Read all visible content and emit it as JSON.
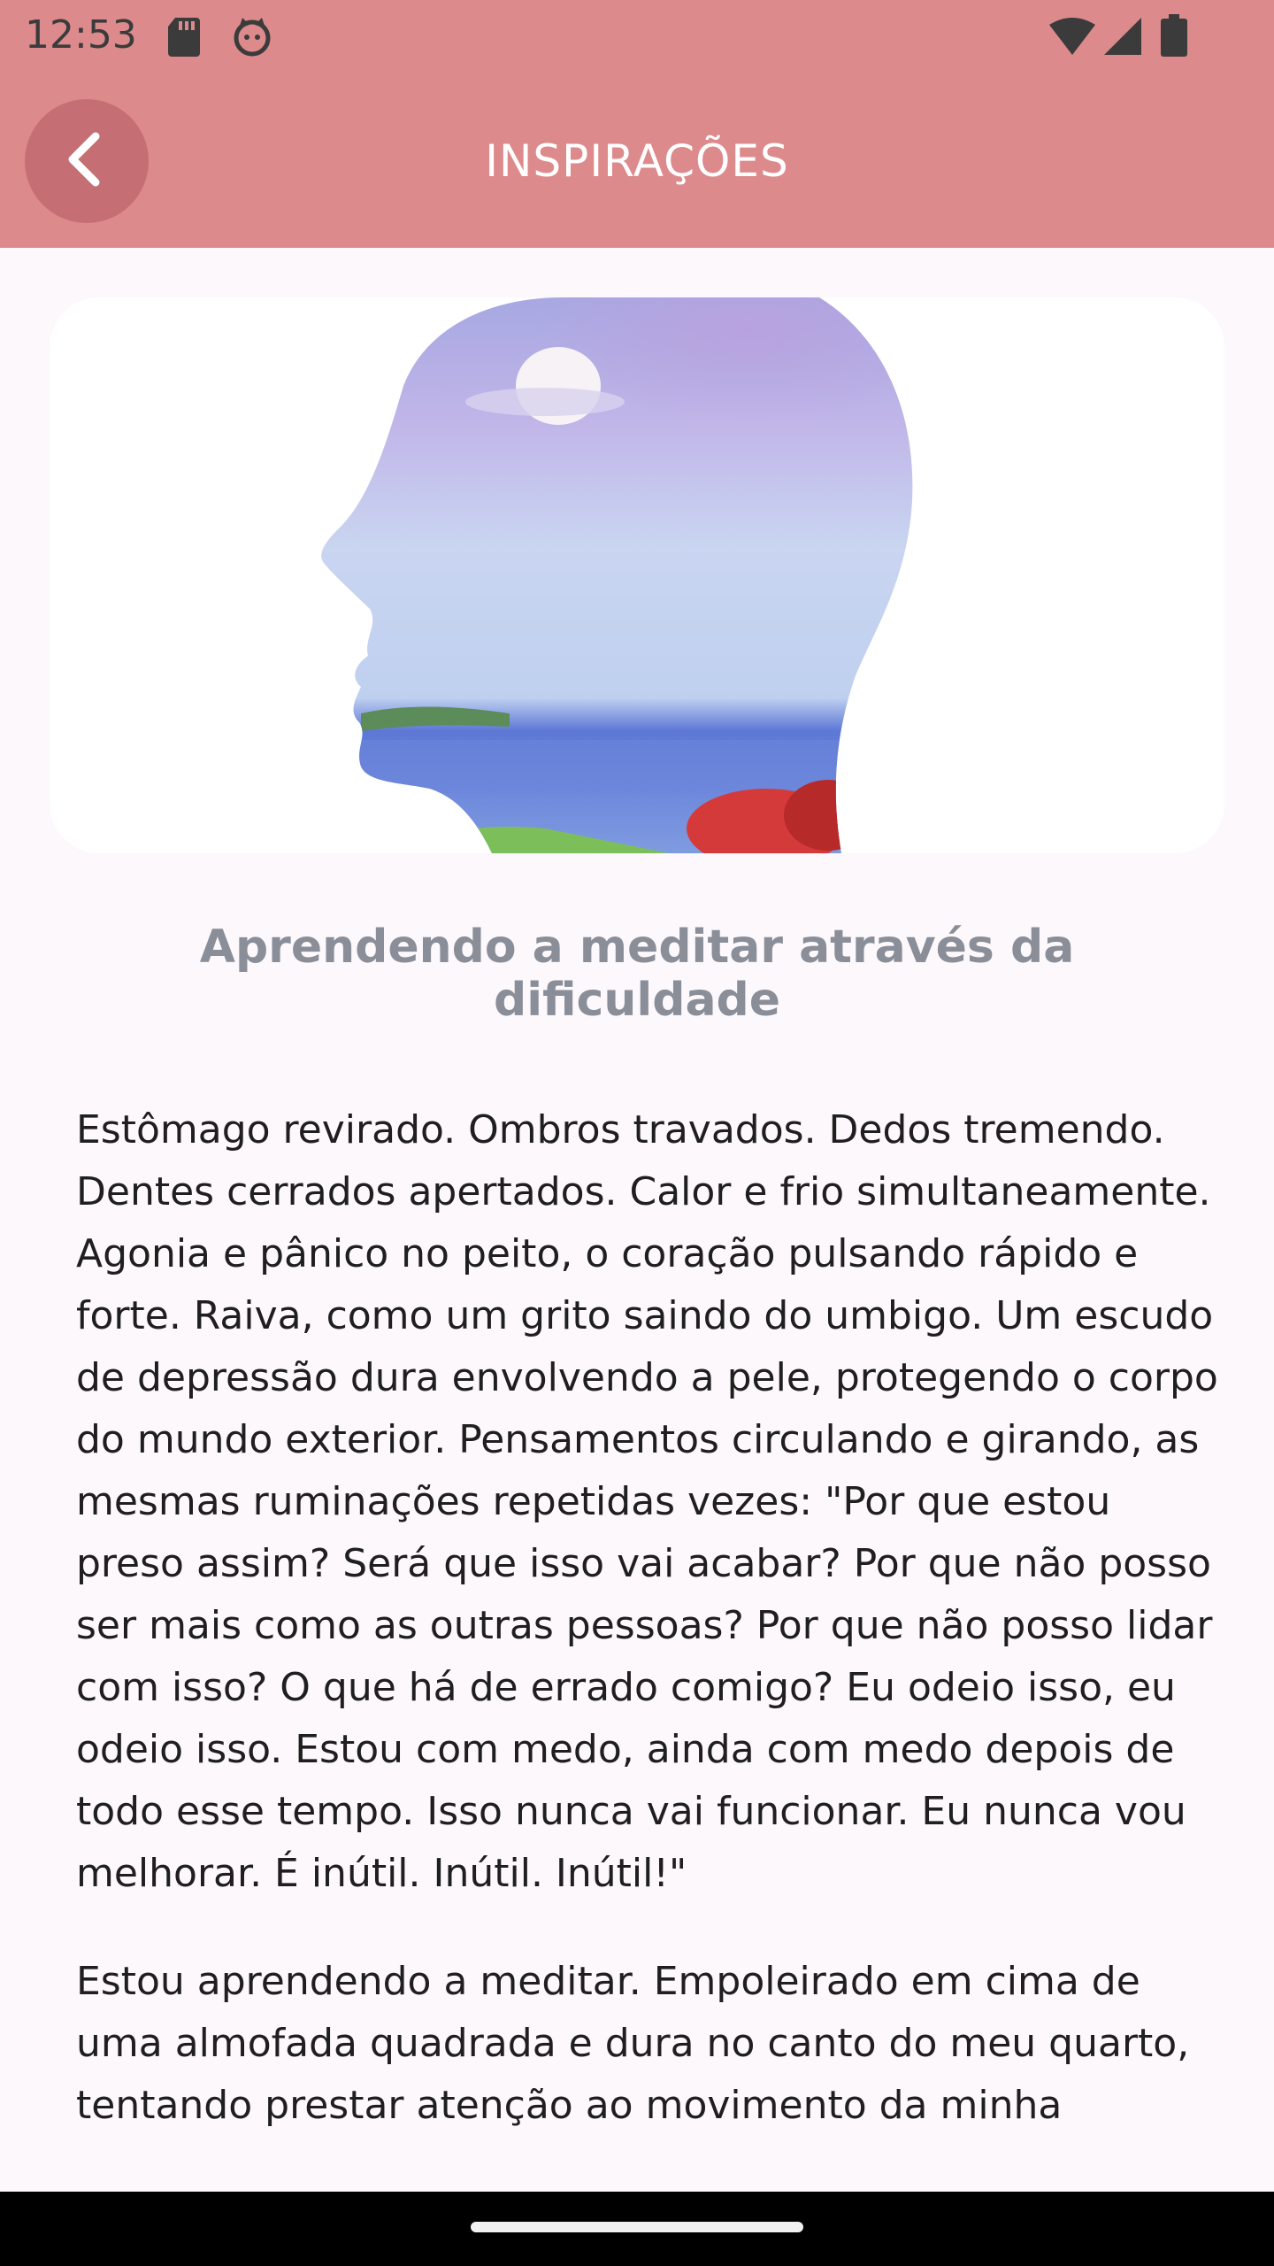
{
  "status_bar": {
    "time": "12:53",
    "icons": [
      "sd-card-icon",
      "cat-face-icon",
      "wifi-icon",
      "cellular-signal-icon",
      "battery-icon"
    ]
  },
  "app_bar": {
    "title": "INSPIRAÇÕES",
    "back_icon": "chevron-left-icon"
  },
  "article": {
    "image": "watercolor-head-silhouette-seascape",
    "title": "Aprendendo a meditar através da dificuldade",
    "paragraphs": [
      "Estômago revirado. Ombros travados. Dedos tremendo. Dentes cerrados apertados. Calor e frio simultaneamente. Agonia e pânico no peito, o coração pulsando rápido e forte. Raiva, como um grito saindo do umbigo. Um escudo de depressão dura envolvendo a pele, protegendo o corpo do mundo exterior. Pensamentos circulando e girando, as mesmas ruminações repetidas vezes: \"Por que estou preso assim? Será que isso vai acabar? Por que não posso ser mais como as outras pessoas? Por que não posso lidar com isso? O que há de errado comigo? Eu odeio isso, eu odeio isso. Estou com medo, ainda com medo depois de todo esse tempo. Isso nunca vai funcionar. Eu nunca vou melhorar. É inútil. Inútil. Inútil!\"",
      "Estou aprendendo a meditar. Empoleirado em cima de uma almofada quadrada e dura no canto do meu quarto, tentando prestar atenção ao movimento da minha"
    ]
  },
  "colors": {
    "app_bar": "#dd8a8c",
    "back_button": "#c56f74",
    "title_text": "#8a8e99",
    "background": "#fdf8fb"
  }
}
